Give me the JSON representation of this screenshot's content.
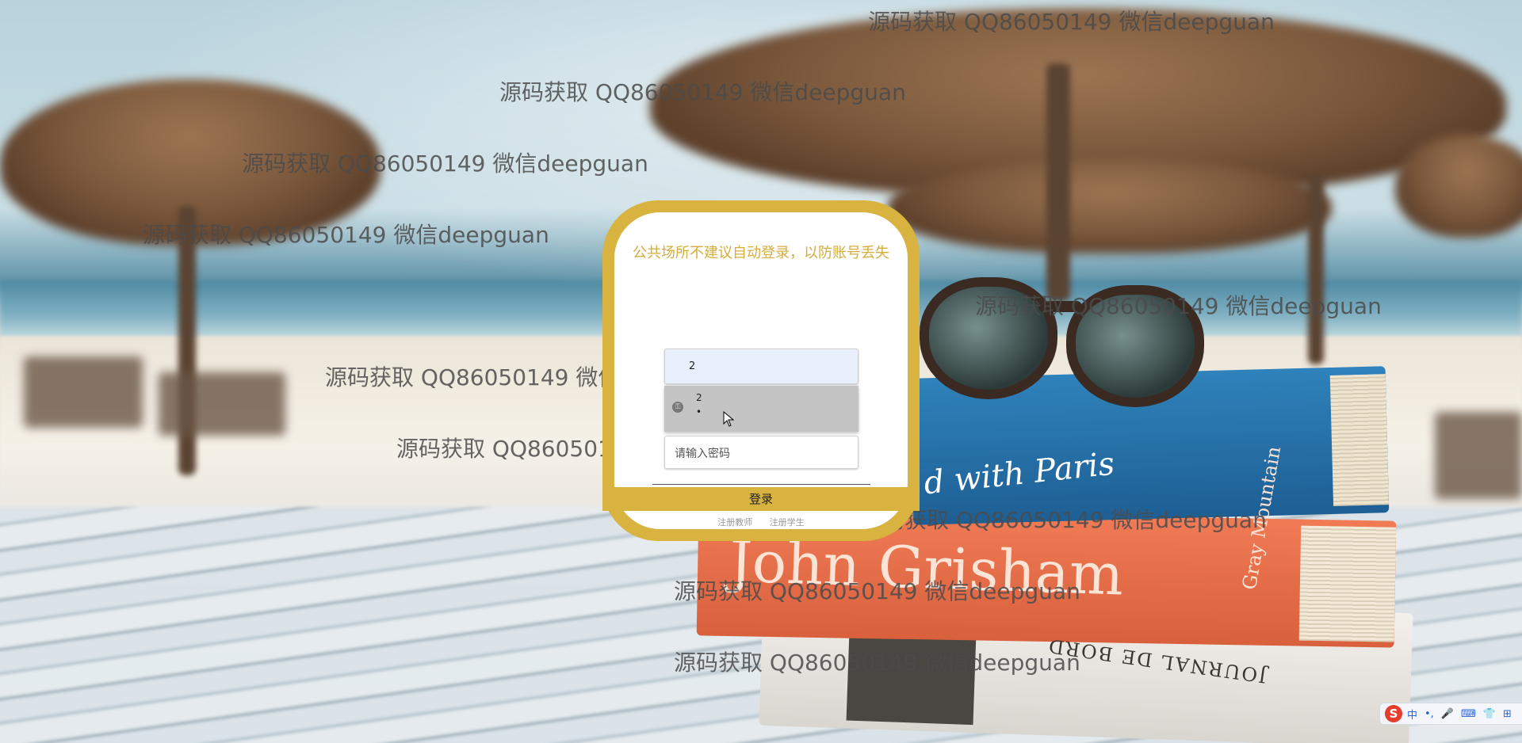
{
  "login": {
    "notice": "公共场所不建议自动登录，以防账号丢失",
    "username_value": "2",
    "autofill": {
      "username": "2",
      "password_mask": "•"
    },
    "password_placeholder": "请输入密码",
    "login_label": "登录",
    "register_teacher": "注册教师",
    "register_student": "注册学生"
  },
  "watermark_text": "源码获取 QQ86050149 微信deepguan",
  "background_text": {
    "blue_book": "d with Paris",
    "red_book": "John Grisham",
    "red_spine": "Gray Mountain",
    "white_book": "JOURNAL DE BORD"
  },
  "ime": {
    "logo": "S",
    "mode": "中",
    "items": [
      "•,",
      "🎤",
      "⌨",
      "👕",
      "⊞"
    ]
  },
  "colors": {
    "accent": "#d8b33f",
    "notice_text": "#d4ad3c",
    "autofill_bg": "#e8f0fe"
  }
}
